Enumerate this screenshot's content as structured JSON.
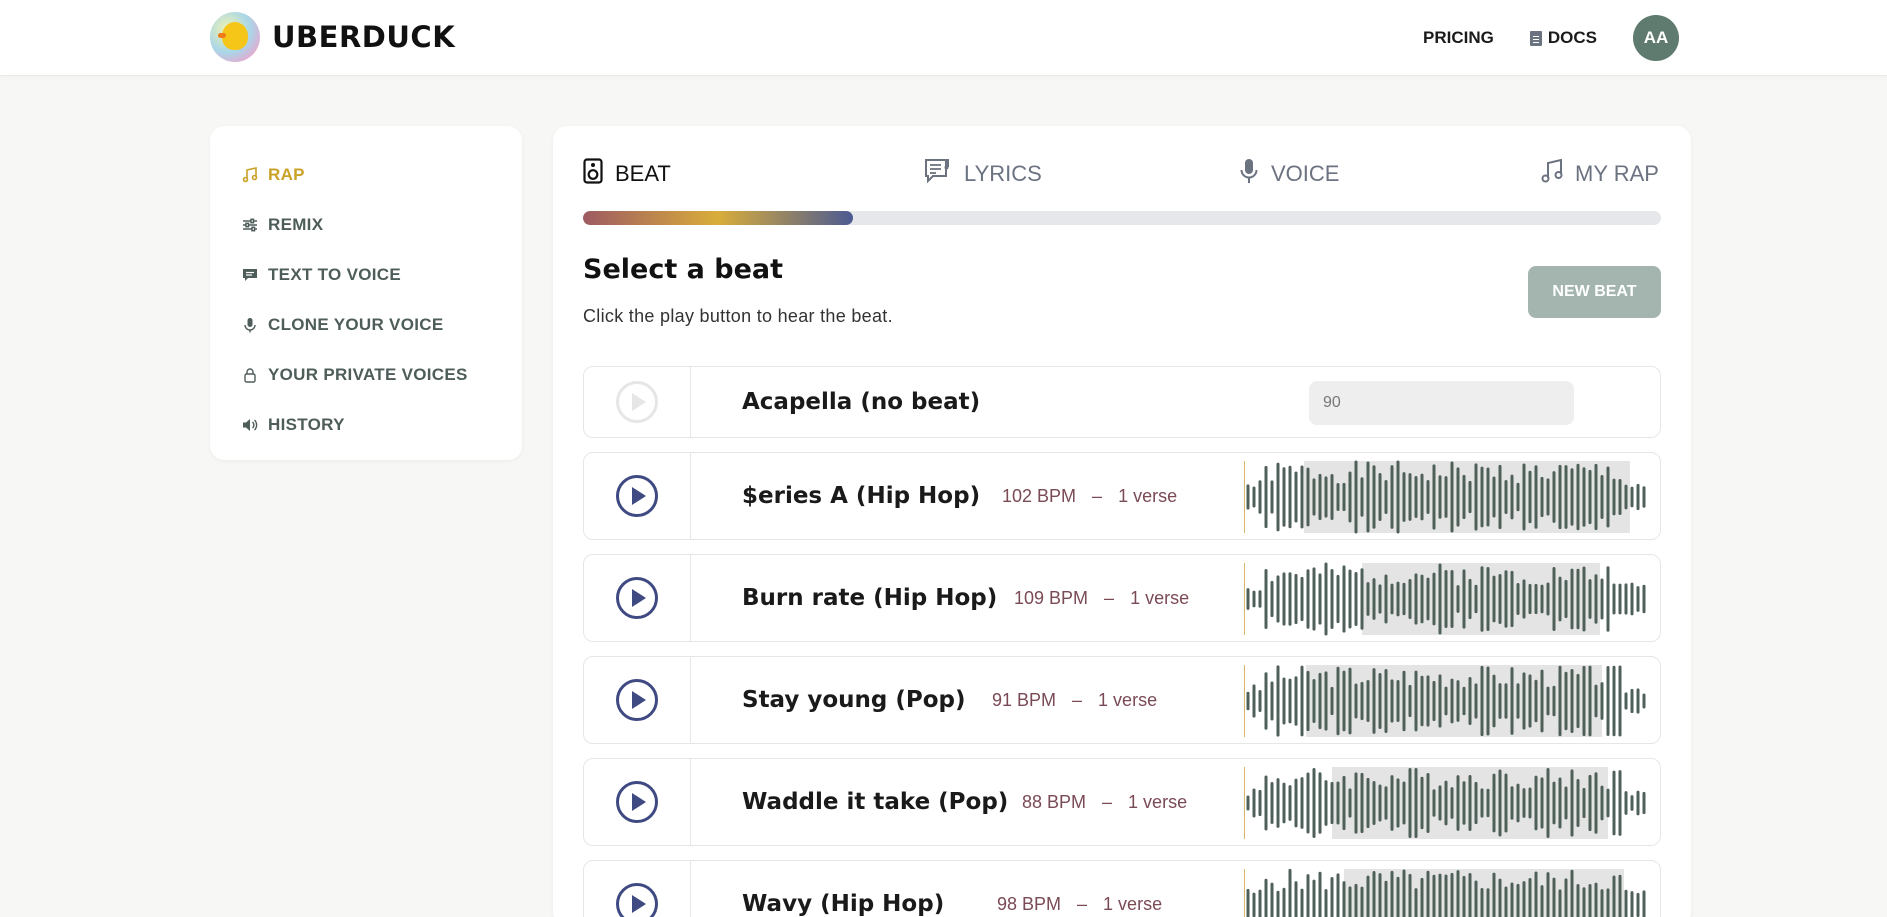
{
  "brand": {
    "name": "UBERDUCK"
  },
  "topnav": {
    "pricing": "PRICING",
    "docs": "DOCS",
    "avatar_initials": "AA"
  },
  "sidebar": {
    "items": [
      {
        "label": "RAP",
        "icon": "music-note-icon",
        "active": true
      },
      {
        "label": "REMIX",
        "icon": "sliders-icon"
      },
      {
        "label": "TEXT TO VOICE",
        "icon": "chat-bubble-icon"
      },
      {
        "label": "CLONE YOUR VOICE",
        "icon": "microphone-icon"
      },
      {
        "label": "YOUR PRIVATE VOICES",
        "icon": "lock-icon"
      },
      {
        "label": "HISTORY",
        "icon": "speaker-icon"
      }
    ]
  },
  "steps": [
    {
      "label": "BEAT",
      "icon": "speaker-box-icon",
      "active": true
    },
    {
      "label": "LYRICS",
      "icon": "lyrics-icon"
    },
    {
      "label": "VOICE",
      "icon": "microphone-icon"
    },
    {
      "label": "MY RAP",
      "icon": "music-note-icon"
    }
  ],
  "progress": {
    "fraction": 0.25
  },
  "main": {
    "title": "Select a beat",
    "subtitle": "Click the play button to hear the beat.",
    "new_beat": "NEW BEAT"
  },
  "acapella": {
    "name": "Acapella (no beat)",
    "bpm_value": "90"
  },
  "beats": [
    {
      "name": "$eries A (Hip Hop)",
      "bpm": "102 BPM",
      "sep": "–",
      "verses": "1 verse"
    },
    {
      "name": "Burn rate (Hip Hop)",
      "bpm": "109 BPM",
      "sep": "–",
      "verses": "1 verse"
    },
    {
      "name": "Stay young (Pop)",
      "bpm": "91 BPM",
      "sep": "–",
      "verses": "1 verse"
    },
    {
      "name": "Waddle it take (Pop)",
      "bpm": "88 BPM",
      "sep": "–",
      "verses": "1 verse"
    },
    {
      "name": "Wavy (Hip Hop)",
      "bpm": "98 BPM",
      "sep": "–",
      "verses": "1 verse"
    }
  ],
  "colors": {
    "accent": "#c9a227",
    "play": "#3f4a82",
    "wave": "#4f6059",
    "meta": "#7a4a55"
  }
}
